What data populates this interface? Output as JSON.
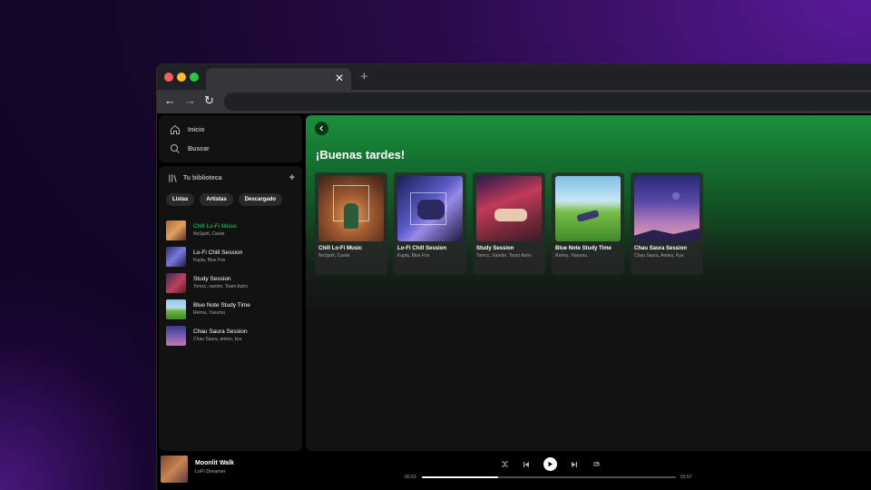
{
  "sidebar": {
    "nav": [
      {
        "label": "Inicio",
        "icon": "home-icon"
      },
      {
        "label": "Buscar",
        "icon": "search-icon"
      }
    ],
    "library_title": "Tu biblioteca",
    "chips": [
      "Listas",
      "Artistas",
      "Descargado"
    ],
    "items": [
      {
        "title": "Chill Lo-Fi Music",
        "subtitle": "NoSpirit, Casiio",
        "active": true
      },
      {
        "title": "Lo-Fi Chill Session",
        "subtitle": "Kupla, Blue Fox",
        "active": false
      },
      {
        "title": "Study Session",
        "subtitle": "Tomcc, xander, Team Astro",
        "active": false
      },
      {
        "title": "Blue Note Study Time",
        "subtitle": "Reimu, Yasumu",
        "active": false
      },
      {
        "title": "Chau Saura Session",
        "subtitle": "Chau Saura, amies, kyu",
        "active": false
      }
    ]
  },
  "main": {
    "greeting": "¡Buenas tardes!",
    "cards": [
      {
        "title": "Chill Lo-Fi Music",
        "subtitle": "NoSpirit, Casiio"
      },
      {
        "title": "Lo-Fi Chill Session",
        "subtitle": "Kupla, Blue Fox"
      },
      {
        "title": "Study Session",
        "subtitle": "Tomcc, Xander, Team Astro"
      },
      {
        "title": "Blue Note Study Time",
        "subtitle": "Reimu, Yasumu"
      },
      {
        "title": "Chau Saura Session",
        "subtitle": "Chau Saura, Amies, Kyu"
      }
    ]
  },
  "player": {
    "title": "Moonlit Walk",
    "artist": "LoFi Dreamer",
    "current_time": "00:53",
    "duration": "02:57",
    "progress_fraction": 0.3
  },
  "colors": {
    "accent_green": "#1ed760",
    "header_green": "#1b8f3c"
  }
}
